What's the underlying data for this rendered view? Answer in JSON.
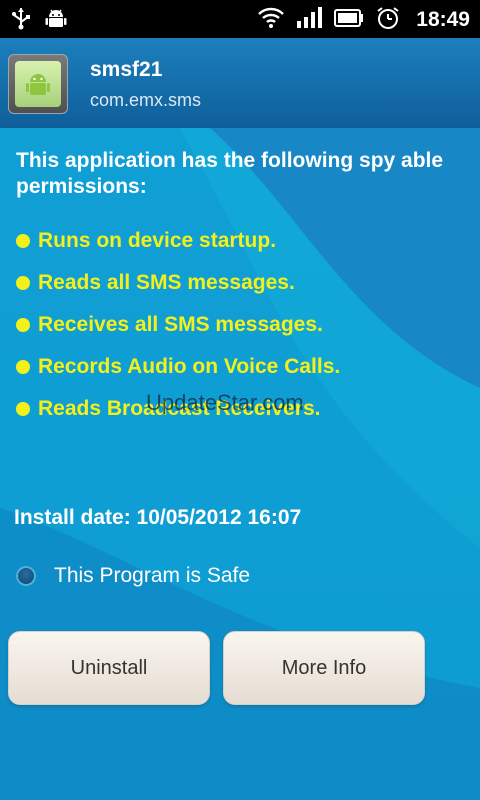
{
  "status_bar": {
    "time": "18:49",
    "icons": [
      "usb-icon",
      "android-debug-icon",
      "wifi-icon",
      "signal-icon",
      "battery-icon",
      "alarm-clock-icon"
    ]
  },
  "header": {
    "app_name": "smsf21",
    "package": "com.emx.sms"
  },
  "permissions": {
    "heading": "This application has the following spy able permissions:",
    "items": [
      "Runs on device startup.",
      "Reads all SMS messages.",
      "Receives all SMS messages.",
      "Records Audio on Voice Calls.",
      "Reads Broadcast Receivers."
    ]
  },
  "watermark": "UpdateStar.com",
  "install": {
    "label": "Install date: 10/05/2012 16:07"
  },
  "safe_option": {
    "label": "This Program is Safe",
    "checked": false
  },
  "buttons": {
    "uninstall": "Uninstall",
    "more_info": "More Info"
  },
  "colors": {
    "header": "#1670b0",
    "background": "#11a8d8",
    "permission_text": "#f4f11a",
    "button_bg": "#f2ebe3"
  }
}
